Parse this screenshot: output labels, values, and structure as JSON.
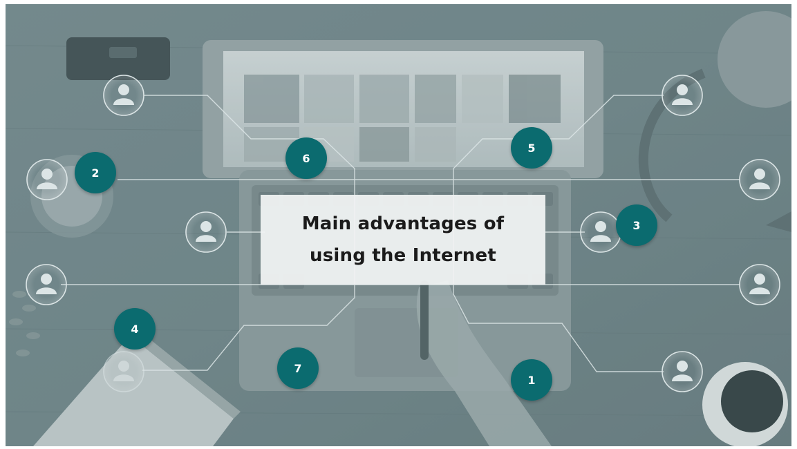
{
  "slide": {
    "title_line1": "Main advantages of",
    "title_line2": "using the Internet"
  },
  "badges": [
    "1",
    "2",
    "3",
    "4",
    "5",
    "6",
    "7"
  ],
  "colors": {
    "badge": "#0b6b6f",
    "overlay": "#7e9498",
    "line": "#dce5e6"
  },
  "icons": [
    "user-icon",
    "laptop-icon",
    "coffee-cup-icon",
    "notebook-icon"
  ]
}
